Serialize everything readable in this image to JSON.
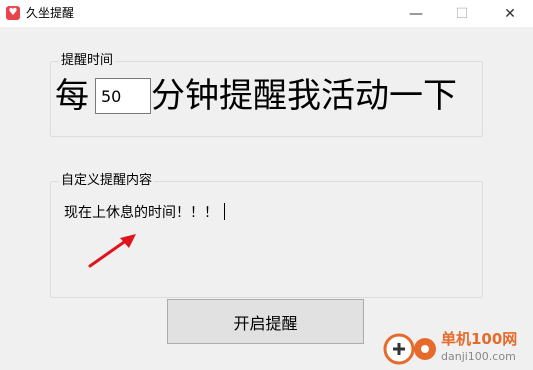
{
  "window": {
    "title": "久坐提醒",
    "minimize_glyph": "—",
    "maximize_glyph": "☐",
    "close_glyph": "✕",
    "app_icon": "heart-icon",
    "app_icon_glyph": "♥"
  },
  "reminder_interval": {
    "group_label": "提醒时间",
    "prefix": "每",
    "minutes_value": "50",
    "suffix": "分钟提醒我活动一下"
  },
  "custom_message": {
    "group_label": "自定义提醒内容",
    "text": "现在上休息的时间！！！"
  },
  "start_button": {
    "label": "开启提醒"
  },
  "watermark": {
    "site_name": "单机100网",
    "domain": "danji100.com"
  },
  "colors": {
    "arrow": "#e0141c",
    "app_icon": "#e8454b",
    "watermark_brand": "#e66a2c"
  }
}
